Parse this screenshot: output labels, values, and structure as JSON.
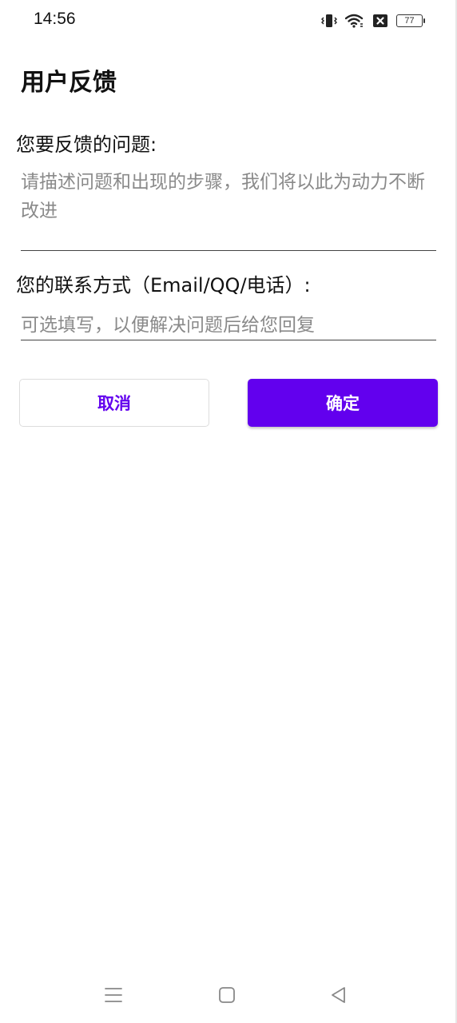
{
  "status_bar": {
    "time": "14:56",
    "battery_level": "77",
    "icons": [
      "vibrate-icon",
      "wifi-icon",
      "sim-blocked-icon",
      "battery-icon"
    ]
  },
  "page": {
    "title": "用户反馈"
  },
  "form": {
    "problem_label": "您要反馈的问题:",
    "problem_placeholder": "请描述问题和出现的步骤，我们将以此为动力不断改进",
    "problem_value": "",
    "contact_label": "您的联系方式（Email/QQ/电话）:",
    "contact_placeholder": "可选填写，以便解决问题后给您回复",
    "contact_value": ""
  },
  "actions": {
    "cancel_label": "取消",
    "confirm_label": "确定"
  },
  "nav_bar": {
    "buttons": [
      "menu-icon",
      "home-icon",
      "back-icon"
    ]
  },
  "colors": {
    "accent": "#6200ee",
    "text": "#111111",
    "placeholder": "#8a8a8a",
    "divider": "#444444"
  }
}
